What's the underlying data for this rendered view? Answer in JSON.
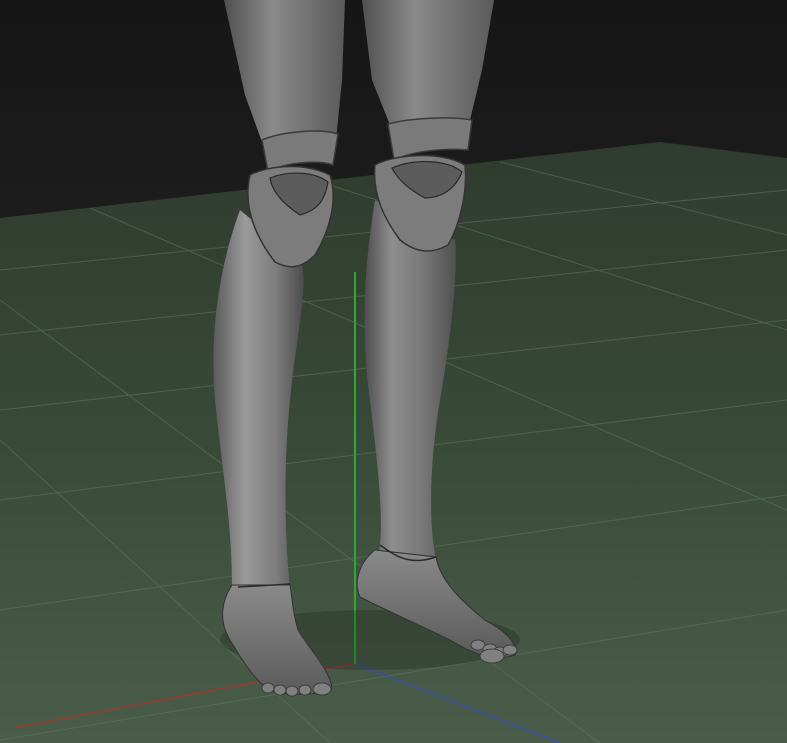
{
  "viewport": {
    "background_top": "#1b1b1b",
    "background_mid": "#2a2a2a",
    "floor_color": "#3c4c3c",
    "grid_color": "#5c7a5c",
    "axis_x_color": "#9a3b2e",
    "axis_y_color": "#2fa82f",
    "axis_z_color": "#3a4fa8",
    "model_color": "#8c8c8c"
  },
  "scene": {
    "object_type": "3D model of legs with separate kneecap and shin pieces",
    "grid_visible": true,
    "axes_visible": [
      "x",
      "y",
      "z"
    ]
  }
}
